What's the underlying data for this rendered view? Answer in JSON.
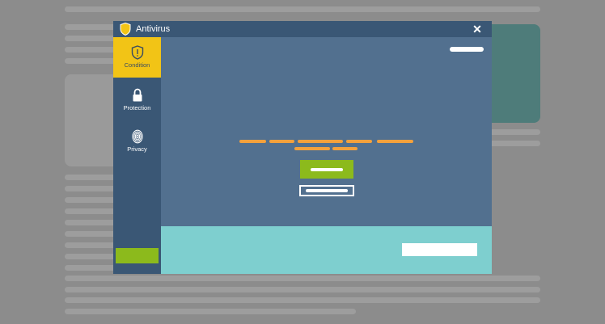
{
  "app": {
    "title": "Antivirus",
    "close_icon": "close-icon",
    "title_icon": "shield-icon"
  },
  "sidebar": {
    "items": [
      {
        "label": "Condition",
        "icon": "shield-alert-icon",
        "active": true
      },
      {
        "label": "Protection",
        "icon": "lock-icon",
        "active": false
      },
      {
        "label": "Privacy",
        "icon": "fingerprint-icon",
        "active": false
      }
    ]
  },
  "colors": {
    "page_background": "#8c8c8c",
    "window_background": "#52708f",
    "titlebar": "#3a5775",
    "accent_yellow": "#f2c416",
    "accent_green": "#8cba1c",
    "message_orange": "#f3a13c",
    "bottom_panel": "#7ecfcf",
    "background_teal_block": "#4e7c7a"
  }
}
